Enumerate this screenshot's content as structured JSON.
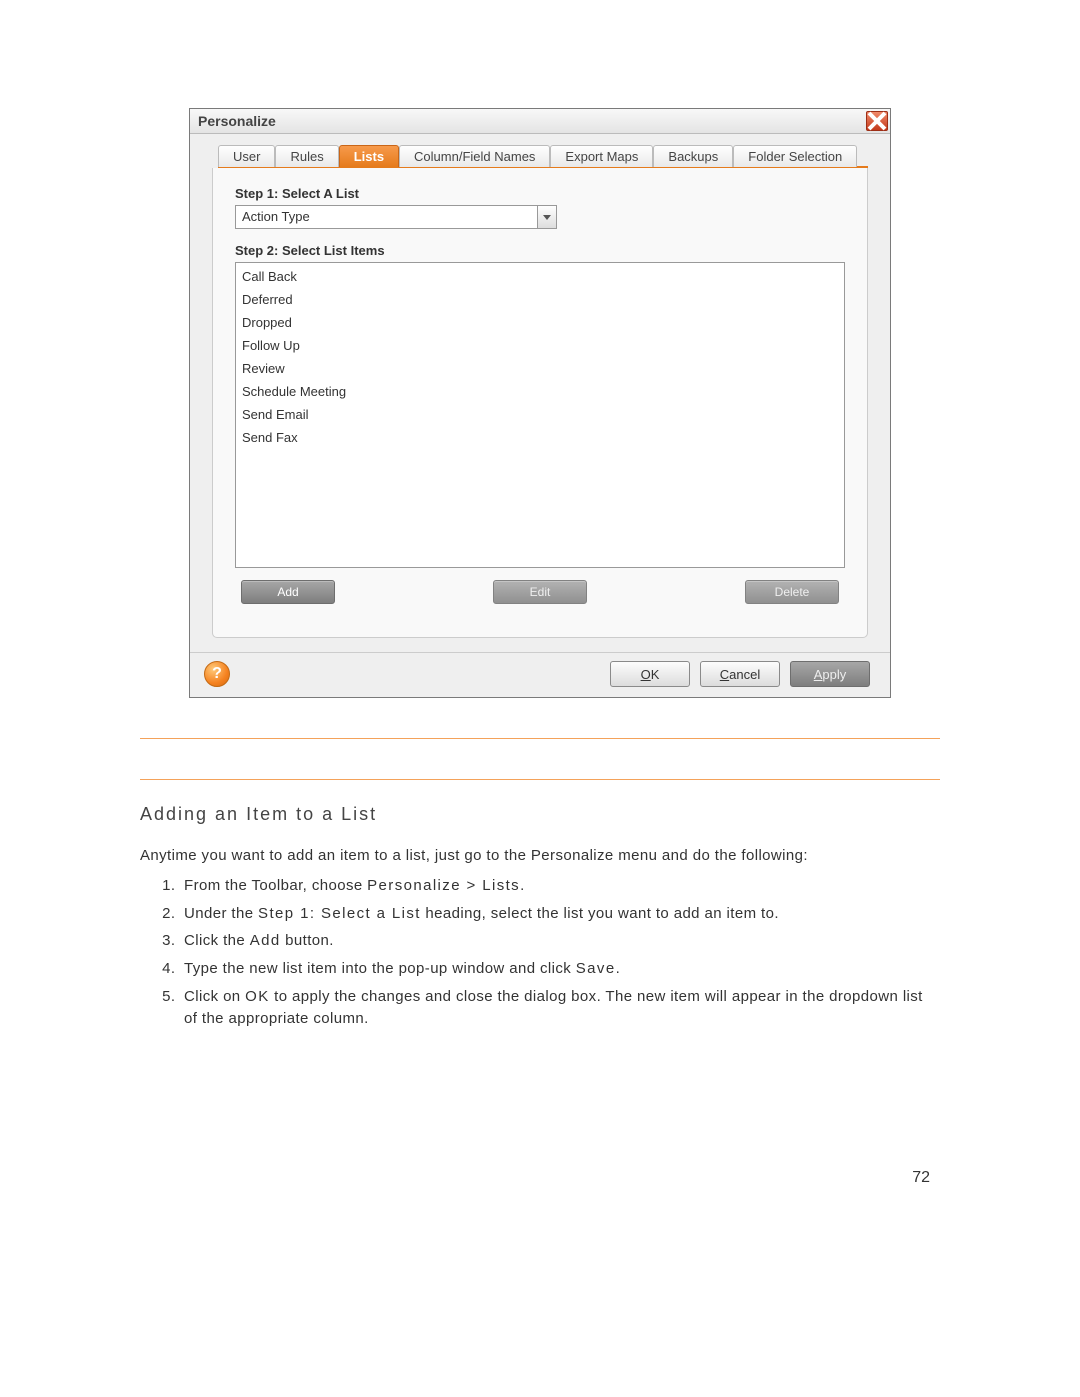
{
  "dialog": {
    "title": "Personalize",
    "tabs": [
      "User",
      "Rules",
      "Lists",
      "Column/Field Names",
      "Export Maps",
      "Backups",
      "Folder Selection"
    ],
    "active_tab": "Lists",
    "step1_label": "Step 1: Select A List",
    "selected_list": "Action Type",
    "step2_label": "Step 2: Select List Items",
    "items": [
      "Call Back",
      "Deferred",
      "Dropped",
      "Follow Up",
      "Review",
      "Schedule Meeting",
      "Send Email",
      "Send Fax"
    ],
    "buttons": {
      "add": "Add",
      "edit": "Edit",
      "delete": "Delete"
    },
    "footer": {
      "ok": "OK",
      "cancel": "Cancel",
      "apply": "Apply"
    }
  },
  "doc": {
    "heading": "Adding an Item to a List",
    "intro": "Anytime you want to add an item to a list, just go to the Personalize menu and do the following:",
    "step1_a": "From the Toolbar, choose ",
    "step1_b": "Personalize > Lists",
    "step1_c": ".",
    "step2_a": "Under the ",
    "step2_b": "Step 1: Select a List",
    "step2_c": " heading, select the list you want to add an item to.",
    "step3_a": "Click the ",
    "step3_b": "Add",
    "step3_c": " button.",
    "step4_a": "Type the new list item into the pop-up window and click ",
    "step4_b": "Save",
    "step4_c": ".",
    "step5_a": "Click on ",
    "step5_b": "OK",
    "step5_c": " to apply the changes and close the dialog box. The new item will appear in the dropdown list of the appropriate column."
  },
  "page_number": "72"
}
